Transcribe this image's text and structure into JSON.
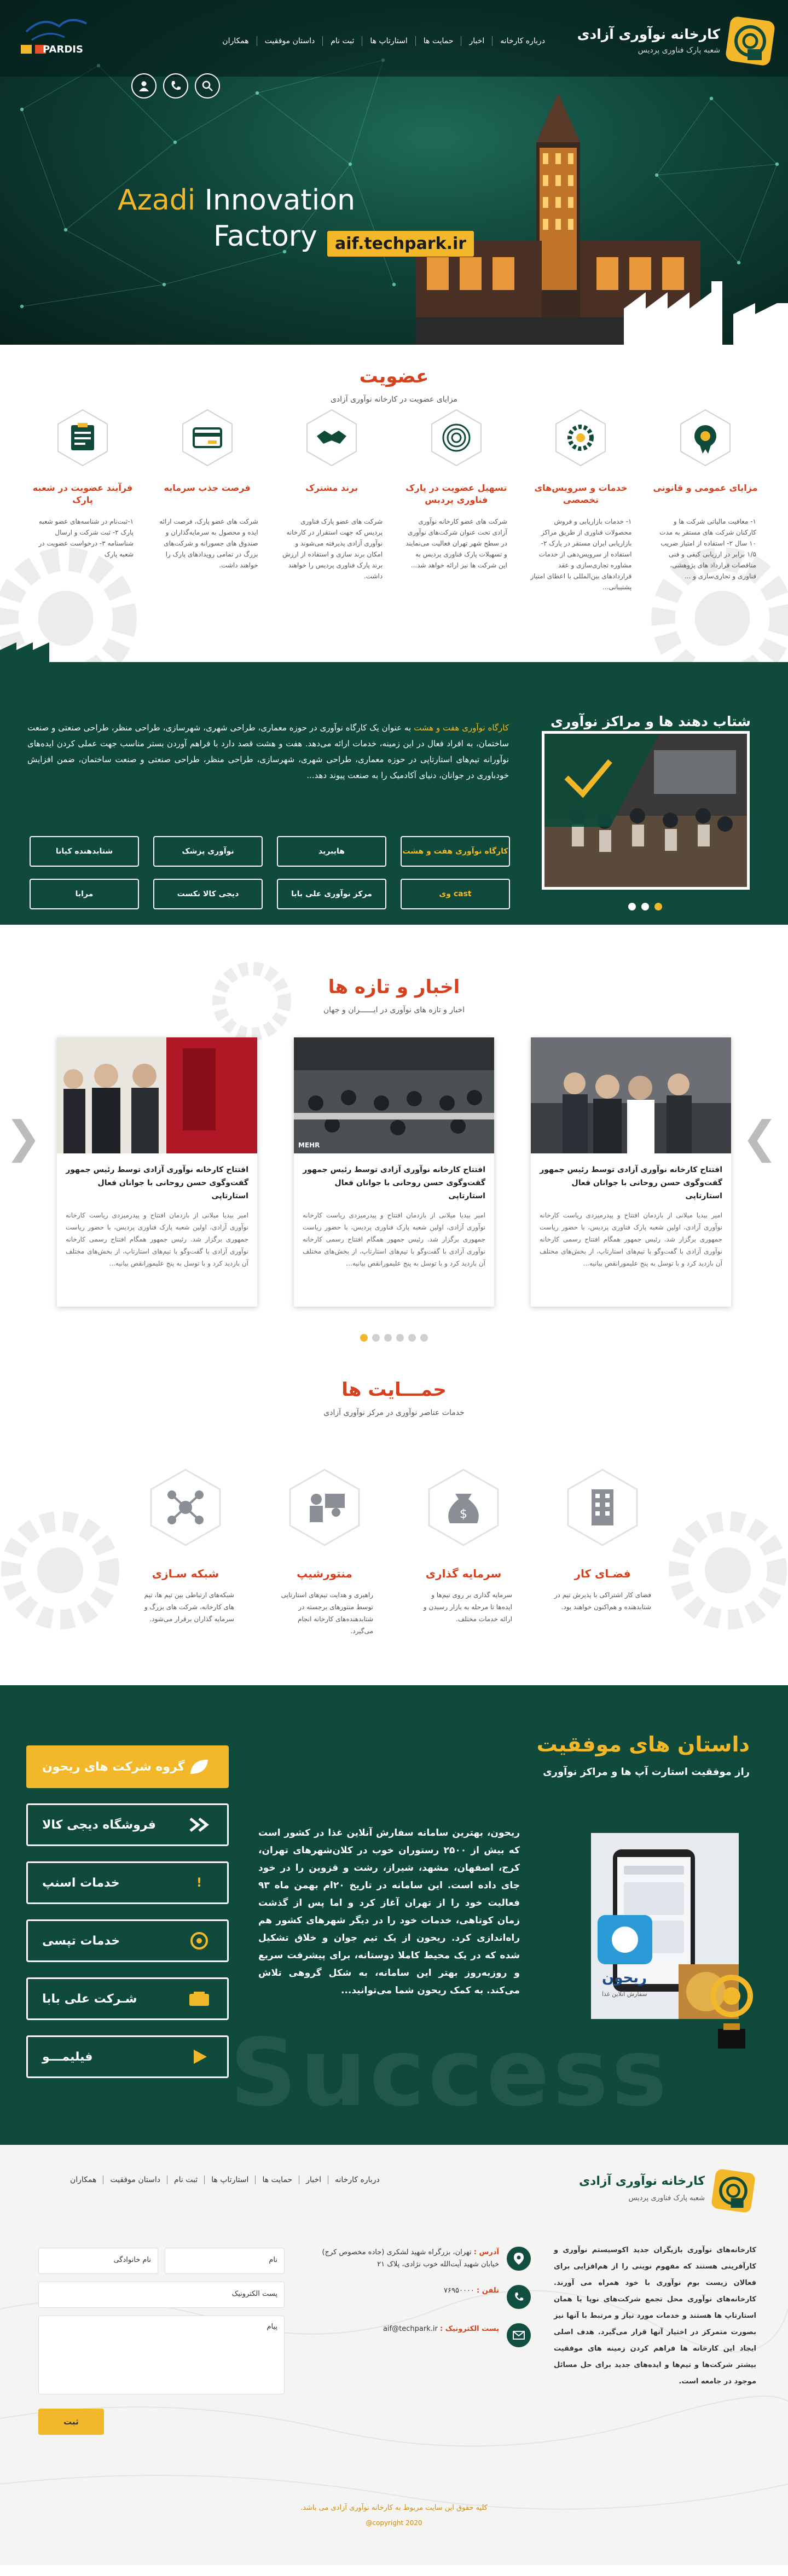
{
  "brand": {
    "title": "کارخانه نوآوری آزادی",
    "subtitle": "شعبه پارک فناوری پردیس"
  },
  "nav": [
    "درباره کارخانه",
    "اخبار",
    "حمایت ها",
    "استارتاپ ها",
    "ثبت نام",
    "داستان موفقیت",
    "همکاران"
  ],
  "hero": {
    "word1": "Azadi",
    "word2": "Innovation",
    "word3": "Factory",
    "url": "aif.techpark.ir",
    "pardis_text": "PARDIS"
  },
  "header_icons": [
    "search-icon",
    "phone-icon",
    "user-icon"
  ],
  "membership": {
    "title": "عضویت",
    "subtitle": "مزایای عضویت در کارخانه نوآوری آزادی",
    "cards": [
      {
        "icon": "badge-icon",
        "title": "مزایای عمومی و قانونی",
        "text": "۱- معافیت مالیاتی شرکت ها و کارکنان شرکت های مستقر به مدت ۱۰ سال ۲- استفاده از امتیاز ضریب ۱/۵ برابر در ارزیابی کیفی و فنی مناقصات قرارداد های پژوهشی، فناوری و تجاری‌سازی و ..."
      },
      {
        "icon": "gear-icon",
        "title": "خدمات و سرویس‌های تخصصی",
        "text": "۱- خدمات بازاریابی و فروش محصولات فناوری از طریق مراکز بازاریابی ایران مستقر در پارک ۲- استفاده از سرویس‌دهی از خدمات مشاوره تجاری‌سازی و عقد قراردادهای بین‌المللی با اعطای امتیاز پشتیبانی..."
      },
      {
        "icon": "fingerprint-icon",
        "title": "تسهیل عضویت در پارک فناوری پردیس",
        "text": "شرکت های عضو کارخانه نوآوری آزادی تحت عنوان شرکت‌های نوآوری در سطح شهر تهران فعالیت می‌نمایند و تسهیلات پارک فناوری پردیس به این شرکت ها نیز ارائه خواهد شد..."
      },
      {
        "icon": "handshake-icon",
        "title": "برند مشترک",
        "text": "شرکت های عضو پارک فناوری پردیس که جهت استقرار در کارخانه نوآوری آزادی پذیرفته می‌شوند و امکان برند سازی و استفاده از ارزش برند پارک فناوری پردیس را خواهند داشت."
      },
      {
        "icon": "card-icon",
        "title": "فرصت جذب سرمایه",
        "text": "شرکت های عضو پارک، فرصت ارائه ایده و محصول به سرمایه‌گذاران و صندوق های جسورانه و شرکت‌های بزرگ در تمامی رویدادهای پارک را خواهند داشت."
      },
      {
        "icon": "clipboard-icon",
        "title": "فرآیند عضویت در شعبه پارک",
        "text": "۱-ثبت‌نام در شناسه‌های عضو شعبه پارک ۲- ثبت شرکت و ارسال شناسنامه ۳- درخواست عضویت در شعبه پارک"
      }
    ]
  },
  "accel": {
    "title": "شتاب دهند ها و مراکز نوآوری",
    "highlight1": "کارگاه نوآوری هفت و هشت",
    "body": "به عنوان یک کارگاه نوآوری در حوزه معماری، طراحی شهری، شهرسازی، طراحی منظر، طراحی صنعتی و صنعت ساختمان، به افراد فعال در این زمینه، خدمات ارائه می‌دهد. هفت و هشت قصد دارد با فراهم آوردن بستر مناسب جهت عملی کردن ایده‌های نوآورانه تیم‌های استارتاپی در حوزه معماری، طراحی شهری، شهرسازی، طراحی منظر، طراحی صنعتی و صنعت ساختمان، ضمن افزایش خودباوری در جوانان، دنیای آکادمیک را به صنعت پیوند دهد...",
    "logos": [
      "کارگاه نوآوری هفت و هشت",
      "هایبرید",
      "نوآوری پزشک",
      "شتابدهنده کیانا",
      "cast وی",
      "مرکز نوآوری علی بابا",
      "دیجی کالا نکست",
      "مرابا"
    ],
    "dots": 3
  },
  "news": {
    "title": "اخبار و تازه ها",
    "subtitle": "اخبار و تازه های نوآوری در ایــــــران و جهان",
    "items": [
      {
        "title": "افتتاح کارخانه نوآوری آزادی توسط رئیس جمهور گفت‌وگوی حسن روحانی با جوانان فعال استارتاپی",
        "text": "امیر بیدیا میلانی از بازدمان افتتاح و پیدرمیزدی ریاست کارخانه نوآوری آزادی، اولین شعبه پارک فناوری پردیس، با حضور رياست جمهوری برگزار شد. رئیس جمهور همگام افتتاح رسمی کارخانه نوآوری آزادی با گفت‌وگو با تیم‌های استارتاپ، از بخش‌های مختلف آن بازدید کرد و با توسل به پنج عليمورانقص بيانيه..."
      },
      {
        "title": "افتتاح کارخانه نوآوری آزادی توسط رئیس جمهور گفت‌وگوی حسن روحانی با جوانان فعال استارتاپی",
        "text": "امیر بیدیا میلانی از بازدمان افتتاح و پیدرمیزدی ریاست کارخانه نوآوری آزادی، اولین شعبه پارک فناوری پردیس، با حضور رياست جمهوری برگزار شد. رئیس جمهور همگام افتتاح رسمی کارخانه نوآوری آزادی با گفت‌وگو با تیم‌های استارتاپ، از بخش‌های مختلف آن بازدید کرد و با توسل به پنج عليمورانقص بيانيه..."
      },
      {
        "title": "افتتاح کارخانه نوآوری آزادی توسط رئیس جمهور گفت‌وگوی حسن روحانی با جوانان فعال استارتاپی",
        "text": "امیر بیدیا میلانی از بازدمان افتتاح و پیدرمیزدی ریاست کارخانه نوآوری آزادی، اولین شعبه پارک فناوری پردیس، با حضور رياست جمهوری برگزار شد. رئیس جمهور همگام افتتاح رسمی کارخانه نوآوری آزادی با گفت‌وگو با تیم‌های استارتاپ، از بخش‌های مختلف آن بازدید کرد و با توسل به پنج عليمورانقص بيانيه..."
      }
    ],
    "image_caption": "MEHR"
  },
  "support": {
    "title": "حمـــایت ها",
    "subtitle": "خدمات عناصر نوآوری در مرکز نوآوری آزادی",
    "items": [
      {
        "icon": "building-icon",
        "title": "فضـای کار",
        "text": "فضای کار اشتراکی با پذیرش تیم در شتابدهنده و هم‌اکنون خواهند بود."
      },
      {
        "icon": "money-bag-icon",
        "title": "سرمایه گذاری",
        "text": "سرمایه گذاری بر روی تیم‌ها و ایده‌ها تا مرحله به بازار رسیدن و ارائه خدمات مختلف."
      },
      {
        "icon": "mentor-icon",
        "title": "منتورشیپ",
        "text": "راهبری و هدایت تیم‌های استارتاپی توسط منتورهای برجسته در شتابدهنده‌های کارخانه انجام می‌گیرد."
      },
      {
        "icon": "network-icon",
        "title": "شبکه سـازی",
        "text": "شبکه‌های ارتباطی بین تیم ها، تیم های کارخانه، شرکت های بزرگ و سرمایه گذاران برقرار می‌شود."
      }
    ]
  },
  "success": {
    "title": "داستان های موفقیت",
    "subtitle": "راز موفقیت استارت آپ ها و مراکز نوآوری",
    "bg_word": "Success",
    "buttons": [
      "گروه شرکت های ریحون",
      "فروشگاه دیجی کالا",
      "خدمات اسنپ",
      "خدمات تپسی",
      "شـرکت علی بابا",
      "فیلیمـــو"
    ],
    "text": "ریحون، بهترین سامانه سفارش آنلاین غذا در کشور است که بیش از ۲۵۰۰ رستوران خوب در کلان‌شهرهای تهران، کرج، اصفهان، مشهد، شیراز، رشت و قزوین را در خود جای داده است. این سامانه در تاریخ ۲۰ام بهمن ماه ۹۳ فعالیت خود را از تهران آغاز کرد و اما پس از گذشت زمان کوتاهی، خدمات خود را در دیگر شهرهای کشور هم راه‌اندازی کرد. ریحون از یک تیم جوان و خلاق تشکیل شده که در یک محیط کاملا دوستانه، برای پیشرفت سریع و روزبه‌روز بهتر این سامانه، به شکل گروهی تلاش می‌کند. به کمک ریحون شما می‌توانید...",
    "app_name": "ریحون",
    "app_tagline": "سفارش آنلاین غذا"
  },
  "footer": {
    "brand_title": "کارخانه نوآوری آزادی",
    "brand_subtitle": "شعبه پارک فناوری پردیس",
    "nav": [
      "درباره کارخانه",
      "اخبار",
      "حمایت ها",
      "استارتاپ ها",
      "ثبت نام",
      "داستان موفقیت",
      "همکاران"
    ],
    "about": "کارخانه‌های نوآوری بازیگران جدید اکوسیستم نوآوری و کارآفرینی هستند که مفهوم نوینی را از هم‌افزایی برای فعالان زیست بوم نوآوری با خود همراه می آورند. کارخانه‌های نوآوری محل تجمع شرکت‌های نوپا یا همان استارتاپ ها هستند و خدمات مورد نیاز و مرتبط با آنها نیز بصورت متمرکز در اختیار آنها قرار می‌گیرد. هدف اصلی ایجاد این کارخانه ها فراهم کردن زمینه های موفقیت بیشتر شرکت‌ها و تیم‌ها و ایده‌های جدید برای حل مسائل موجود در جامعه است.",
    "address_label": "آدرس :",
    "address": "تهران، بزرگراه شهید لشکری (جاده مخصوص کرج) خیابان شهید آیت‌الله خوب نژادی، پلاک ۲۱",
    "phone_label": "تلفن :",
    "phone": "۷۶۹۵۰۰۰۰",
    "email_label": "پست الکترونیک :",
    "email": "aif@techpark.ir",
    "form": {
      "name": "نام",
      "lastname": "نام خانوادگی",
      "email": "پست الکترونیک",
      "message": "پیام",
      "submit": "ثبت"
    },
    "copy1": "کلیه حقوق این سایت مربوط به کارخانه نوآوری آزادی می باشد.",
    "copy2": "@copyright 2020"
  },
  "colors": {
    "green": "#0f4a3a",
    "orange": "#d6401c",
    "yellow": "#f2b82a"
  }
}
